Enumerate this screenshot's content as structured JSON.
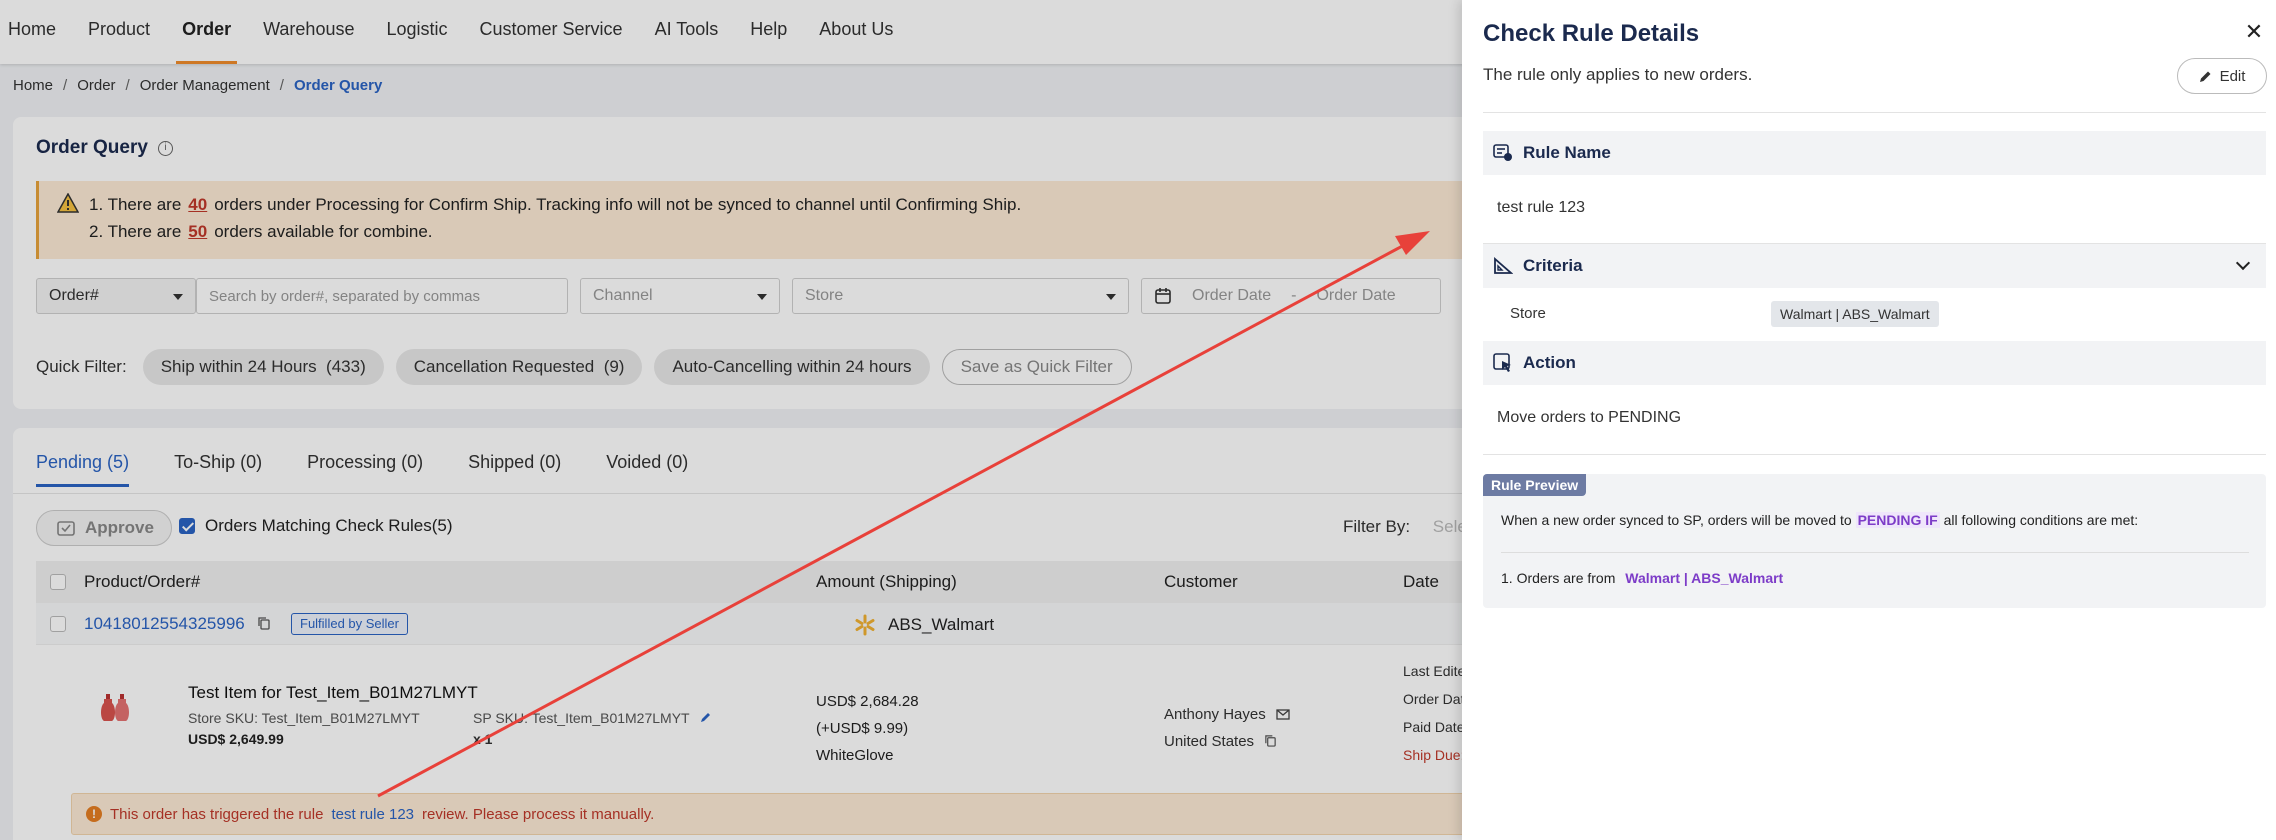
{
  "nav": {
    "items": [
      "Home",
      "Product",
      "Order",
      "Warehouse",
      "Logistic",
      "Customer Service",
      "AI Tools",
      "Help",
      "About Us"
    ],
    "active": "Order"
  },
  "breadcrumb": [
    "Home",
    "Order",
    "Order Management",
    "Order Query"
  ],
  "order_query": {
    "title": "Order Query",
    "warning_line1_prefix": "1. There are",
    "warning_line1_count": "40",
    "warning_line1_suffix": "orders under Processing for Confirm Ship. Tracking info will not be synced to channel until Confirming Ship.",
    "warning_line2_prefix": "2. There are",
    "warning_line2_count": "50",
    "warning_line2_suffix": "orders available for combine.",
    "filters": {
      "order_type": "Order#",
      "search_placeholder": "Search by order#, separated by commas",
      "channel_placeholder": "Channel",
      "store_placeholder": "Store",
      "date_from_placeholder": "Order Date",
      "date_sep": "-",
      "date_to_placeholder": "Order Date"
    },
    "quick_filter_label": "Quick Filter:",
    "quick_filters": [
      "Ship within 24 Hours  (433)",
      "Cancellation Requested  (9)",
      "Auto-Cancelling within 24 hours"
    ],
    "save_quick_filter": "Save as Quick Filter"
  },
  "orders": {
    "tabs": [
      "Pending (5)",
      "To-Ship (0)",
      "Processing (0)",
      "Shipped (0)",
      "Voided (0)"
    ],
    "active_tab": "Pending (5)",
    "approve_label": "Approve",
    "matching_label": "Orders Matching Check Rules(5)",
    "filter_by_label": "Filter By:",
    "filter_by_placeholder": "Sele",
    "columns": [
      "Product/Order#",
      "Amount (Shipping)",
      "Customer",
      "Date"
    ],
    "order": {
      "number": "10418012554325996",
      "badge": "Fulfilled by Seller",
      "store": "ABS_Walmart",
      "item_name": "Test Item for Test_Item_B01M27LMYT",
      "store_sku": "Store SKU: Test_Item_B01M27LMYT",
      "sp_sku": "SP SKU: Test_Item_B01M27LMYT",
      "item_price": "USD$ 2,649.99",
      "qty": "x 1",
      "amount": "USD$ 2,684.28",
      "shipping": "(+USD$ 9.99)",
      "shipping_method": "WhiteGlove",
      "customer_name": "Anthony Hayes",
      "customer_country": "United States",
      "date_labels": [
        "Last Edited",
        "Order Date",
        "Paid Date:",
        "Ship Due:"
      ],
      "trigger_prefix": "This order has triggered the rule",
      "trigger_rule": "test rule 123",
      "trigger_suffix": "review. Please process it manually."
    }
  },
  "drawer": {
    "title": "Check Rule Details",
    "subtitle": "The rule only applies to new orders.",
    "edit_label": "Edit",
    "rule_name_header": "Rule Name",
    "rule_name": "test rule 123",
    "criteria_header": "Criteria",
    "criteria_field": "Store",
    "criteria_value": "Walmart | ABS_Walmart",
    "action_header": "Action",
    "action_value": "Move orders to PENDING",
    "preview_label": "Rule Preview",
    "preview_prefix": "When a new order synced to SP, orders will be moved to",
    "preview_highlight": "PENDING IF",
    "preview_suffix": "all following conditions are met:",
    "preview_condition_prefix": "1. Orders are from",
    "preview_condition_value": "Walmart | ABS_Walmart"
  },
  "colors": {
    "accent_blue": "#2a63c4",
    "nav_active_underline": "#f08c2c",
    "warning_red": "#c0392b",
    "annotation_arrow": "#e8413a",
    "highlight_purple": "#7d3cc8"
  }
}
